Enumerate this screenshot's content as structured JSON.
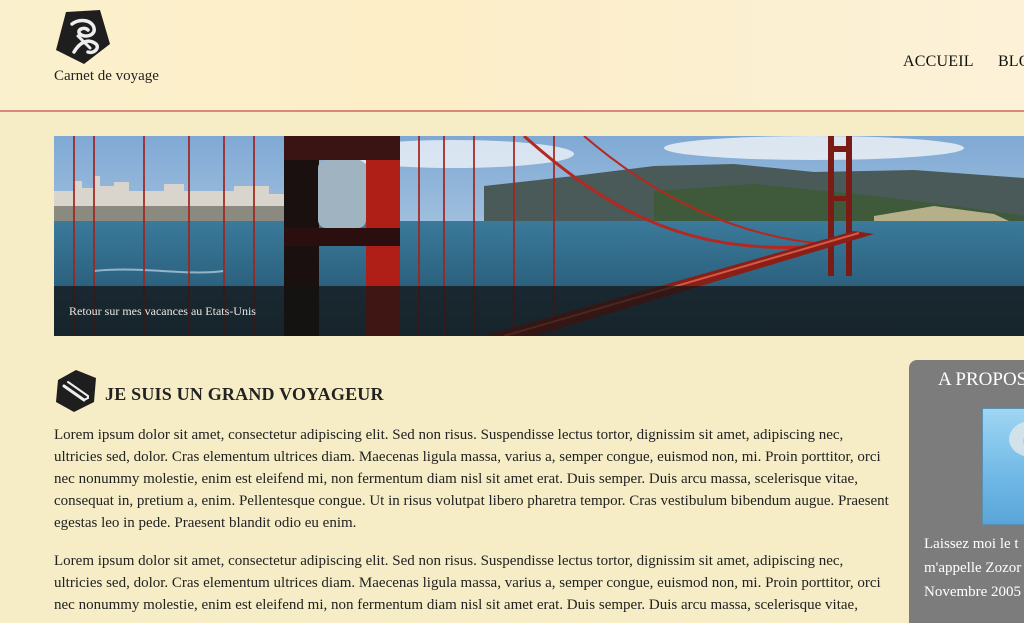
{
  "header": {
    "logo": "stylized-letter-logo",
    "site_title": "Carnet de voyage",
    "nav": [
      "ACCUEIL",
      "BLOG"
    ]
  },
  "banner": {
    "caption": "Retour sur mes vacances au Etats-Unis"
  },
  "article": {
    "icon": "pen-icon",
    "title": "JE SUIS UN GRAND VOYAGEUR",
    "paragraphs": [
      "Lorem ipsum dolor sit amet, consectetur adipiscing elit. Sed non risus. Suspendisse lectus tortor, dignissim sit amet, adipiscing nec, ultricies sed, dolor. Cras elementum ultrices diam. Maecenas ligula massa, varius a, semper congue, euismod non, mi. Proin porttitor, orci nec nonummy molestie, enim est eleifend mi, non fermentum diam nisl sit amet erat. Duis semper. Duis arcu massa, scelerisque vitae, consequat in, pretium a, enim. Pellentesque congue. Ut in risus volutpat libero pharetra tempor. Cras vestibulum bibendum augue. Praesent egestas leo in pede. Praesent blandit odio eu enim.",
      "Lorem ipsum dolor sit amet, consectetur adipiscing elit. Sed non risus. Suspendisse lectus tortor, dignissim sit amet, adipiscing nec, ultricies sed, dolor. Cras elementum ultrices diam. Maecenas ligula massa, varius a, semper congue, euismod non, mi. Proin porttitor, orci nec nonummy molestie, enim est eleifend mi, non fermentum diam nisl sit amet erat. Duis semper. Duis arcu massa, scelerisque vitae,"
    ]
  },
  "sidebar": {
    "title": "A PROPOS",
    "text": "Laissez moi le t m'appelle Zozor Novembre 2005"
  },
  "colors": {
    "page_bg": "#f6edc6",
    "header_border": "#d9897a",
    "sidebar_bg": "#7c7c7c",
    "bridge_red": "#c0281e"
  }
}
